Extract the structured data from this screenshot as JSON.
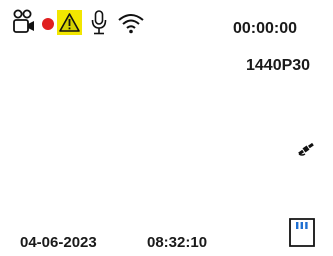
{
  "status_bar": {
    "icons": [
      "dashcam-icon",
      "recording-dot-icon",
      "warning-icon",
      "microphone-icon",
      "wifi-icon"
    ],
    "recording_color": "#e02020",
    "warning_fill": "#f2e600"
  },
  "recording": {
    "elapsed_time": "00:00:00",
    "resolution": "1440P30"
  },
  "gps": {
    "icon": "satellite-icon"
  },
  "footer": {
    "date": "04-06-2023",
    "time": "08:32:10",
    "storage_icon": "sd-card-icon",
    "storage_color": "#1f6fd1"
  }
}
